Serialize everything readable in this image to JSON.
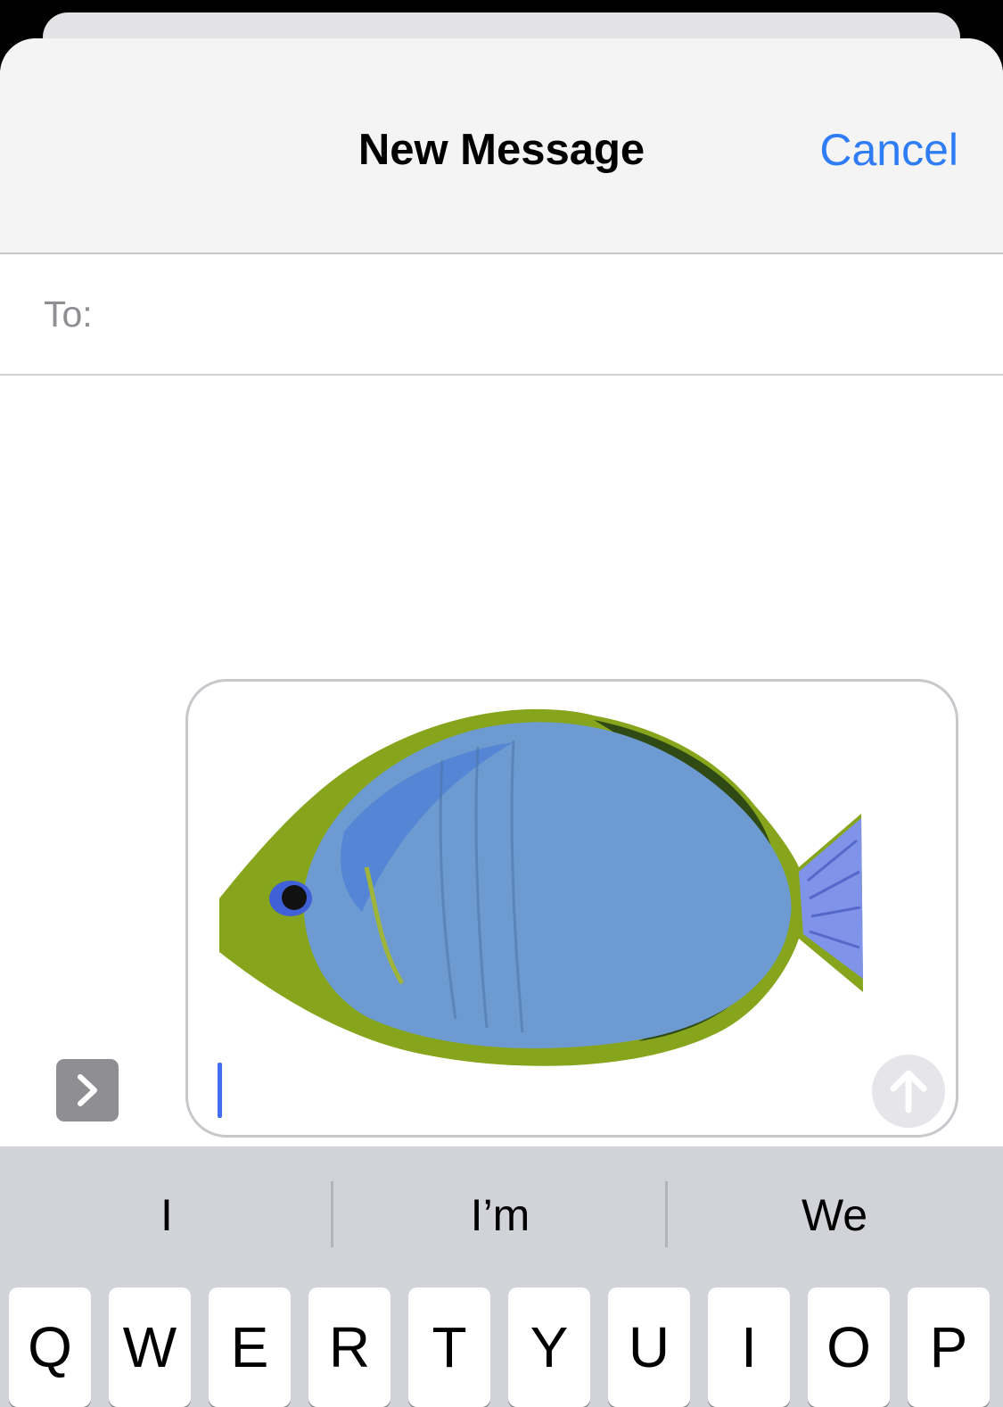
{
  "navbar": {
    "title": "New Message",
    "cancel_label": "Cancel"
  },
  "recipients": {
    "label": "To:",
    "value": ""
  },
  "compose": {
    "text": "",
    "attachment_icon": "fish-sticker-icon"
  },
  "controls": {
    "expand_icon": "chevron-right-icon",
    "send_icon": "arrow-up-icon"
  },
  "keyboard": {
    "suggestions": [
      "I",
      "I’m",
      "We"
    ],
    "keys": [
      "Q",
      "W",
      "E",
      "R",
      "T",
      "Y",
      "U",
      "I",
      "O",
      "P"
    ]
  },
  "colors": {
    "accent": "#2e7cf6",
    "navbar_bg": "#f4f4f5",
    "keyboard_bg": "#d2d3d8",
    "caret": "#3f6ff0"
  }
}
